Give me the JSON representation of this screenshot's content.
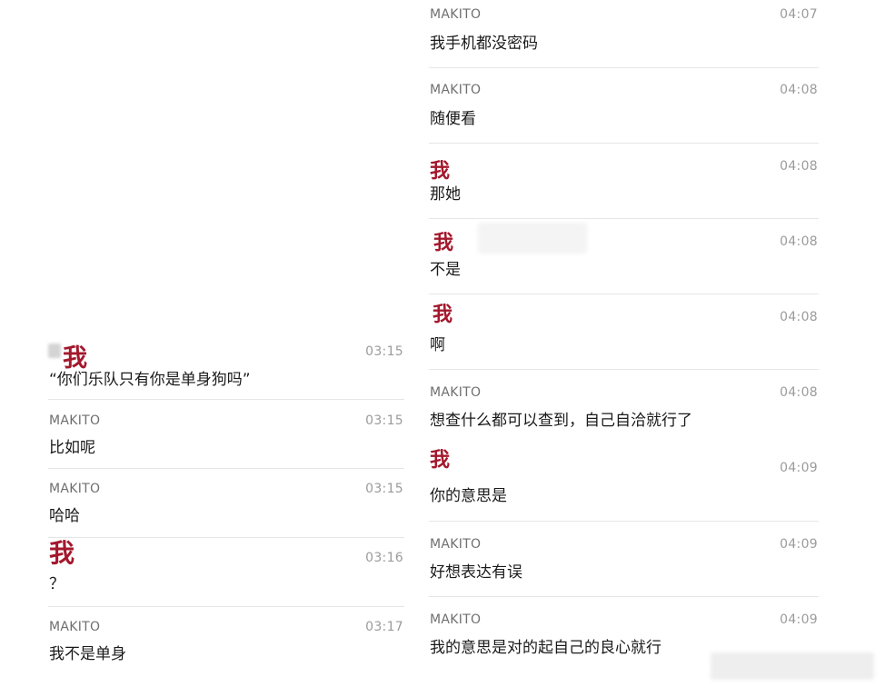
{
  "left_column": {
    "messages": [
      {
        "sender": "我",
        "time": "03:15",
        "text": "“你们乐队只有你是单身狗吗”"
      },
      {
        "sender": "MAKITO",
        "time": "03:15",
        "text": "比如呢"
      },
      {
        "sender": "MAKITO",
        "time": "03:15",
        "text": "哈哈"
      },
      {
        "sender": "我",
        "time": "03:16",
        "text": "？"
      },
      {
        "sender": "MAKITO",
        "time": "03:17",
        "text": "我不是单身"
      }
    ]
  },
  "right_column": {
    "messages": [
      {
        "sender": "MAKITO",
        "time": "04:07",
        "text": "我手机都没密码"
      },
      {
        "sender": "MAKITO",
        "time": "04:08",
        "text": "随便看"
      },
      {
        "sender": "我",
        "time": "04:08",
        "text": "那她"
      },
      {
        "sender": "我",
        "time": "04:08",
        "text": "不是"
      },
      {
        "sender": "我",
        "time": "04:08",
        "text": "啊"
      },
      {
        "sender": "MAKITO",
        "time": "04:08",
        "text": "想查什么都可以查到，自己自洽就行了"
      },
      {
        "sender": "我",
        "time": "04:09",
        "text": "你的意思是"
      },
      {
        "sender": "MAKITO",
        "time": "04:09",
        "text": "好想表达有误"
      },
      {
        "sender": "MAKITO",
        "time": "04:09",
        "text": "我的意思是对的起自己的良心就行"
      }
    ]
  },
  "colors": {
    "me_accent": "#a3182d",
    "makito_name": "#6f6f6f",
    "timestamp": "#9b9b9b",
    "divider": "#e6e6e6",
    "message_text": "#1a1a1a"
  }
}
